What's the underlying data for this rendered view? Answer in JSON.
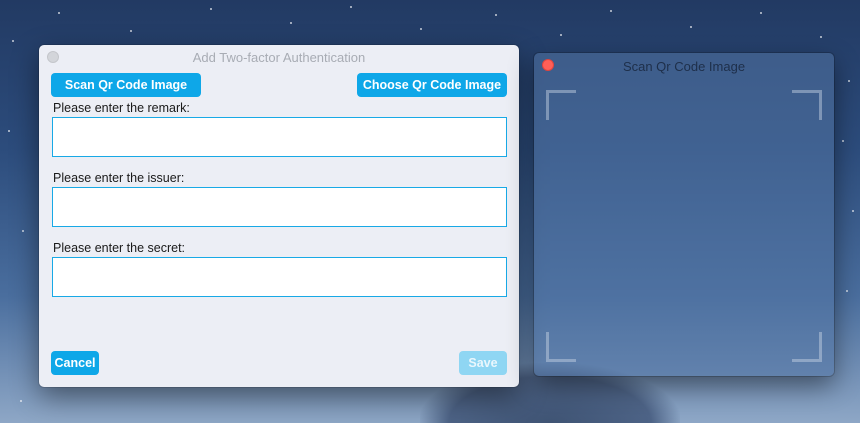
{
  "main_window": {
    "title": "Add Two-factor Authentication",
    "scan_button": "Scan Qr Code Image",
    "choose_button": "Choose Qr Code Image",
    "fields": [
      {
        "label": "Please enter the remark:",
        "value": ""
      },
      {
        "label": "Please enter the issuer:",
        "value": ""
      },
      {
        "label": "Please enter the secret:",
        "value": ""
      }
    ],
    "cancel_button": "Cancel",
    "save_button": "Save"
  },
  "scan_window": {
    "title": "Scan Qr Code Image"
  },
  "colors": {
    "accent": "#0ea7e8",
    "accent_disabled": "#8fd6f3",
    "close_button": "#fe5f57"
  },
  "icons": [
    "close-icon",
    "window-button-icon",
    "scan-frame-corner-icon"
  ]
}
